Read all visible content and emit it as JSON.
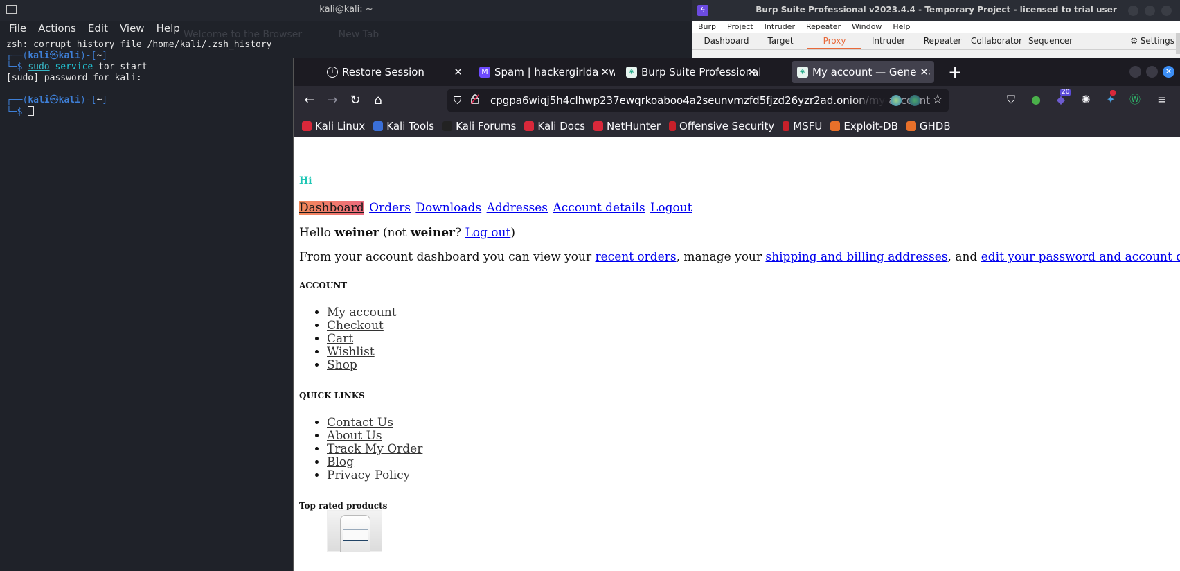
{
  "terminal": {
    "title": "kali@kali: ~",
    "menu": [
      "File",
      "Actions",
      "Edit",
      "View",
      "Help"
    ],
    "ghost_tabs": [
      "Welcome to the Browser",
      "New Tab"
    ],
    "lines": {
      "l1": "zsh: corrupt history file /home/kali/.zsh_history",
      "prompt_open": "┌──(",
      "user": "kali",
      "at": "㉿",
      "host": "kali",
      "prompt_mid": ")-[",
      "dir": "~",
      "prompt_close": "]",
      "prompt_end": "└─$ ",
      "cmd_sudo": "sudo",
      "cmd_service": " service",
      "cmd_rest": " tor start",
      "l4": "[sudo] password for kali:"
    }
  },
  "burp": {
    "title": "Burp Suite Professional v2023.4.4 - Temporary Project - licensed to trial user",
    "menu": [
      "Burp",
      "Project",
      "Intruder",
      "Repeater",
      "Window",
      "Help"
    ],
    "tabs": [
      "Dashboard",
      "Target",
      "Proxy",
      "Intruder",
      "Repeater",
      "Collaborator",
      "Sequencer"
    ],
    "active_tab": "Proxy",
    "settings_label": "Settings",
    "accent": "#e8693a"
  },
  "firefox": {
    "tabs": [
      {
        "label": "Restore Session",
        "icon": "info-icon"
      },
      {
        "label": "Spam | hackergirldarkweb",
        "icon": "proton-mail-icon"
      },
      {
        "label": "Burp Suite Professional",
        "icon": "burp-shield-icon"
      },
      {
        "label": "My account — Genesis Dr",
        "icon": "burp-shield-icon"
      }
    ],
    "url": {
      "host": "cpgpa6wiqj5h4clhwp237ewqrkoaboo4a2seunvmzfd5fjzd26yzr2ad.onion",
      "path": "/my-account"
    },
    "toolbar_badges": {
      "extension_count": "20"
    },
    "bookmarks": [
      "Kali Linux",
      "Kali Tools",
      "Kali Forums",
      "Kali Docs",
      "NetHunter",
      "Offensive Security",
      "MSFU",
      "Exploit-DB",
      "GHDB"
    ]
  },
  "page": {
    "greeting": "Hi",
    "account_nav": [
      "Dashboard",
      "Orders",
      "Downloads",
      "Addresses",
      "Account details",
      "Logout"
    ],
    "hello": {
      "prefix": "Hello ",
      "name": "weiner",
      "mid": " (not ",
      "name2": "weiner",
      "q": "? ",
      "logout": "Log out",
      "end": ")"
    },
    "intro": {
      "t1": "From your account dashboard you can view your ",
      "l1": "recent orders",
      "t2": ", manage your ",
      "l2": "shipping and billing addresses",
      "t3": ", and ",
      "l3": "edit your password and account details",
      "t4": "."
    },
    "account_title": "ACCOUNT",
    "account_links": [
      "My account",
      "Checkout",
      "Cart",
      "Wishlist",
      "Shop"
    ],
    "quick_title": "QUICK LINKS",
    "quick_links": [
      "Contact Us",
      "About Us",
      "Track My Order",
      "Blog",
      "Privacy Policy"
    ],
    "top_rated_title": "Top rated products"
  }
}
